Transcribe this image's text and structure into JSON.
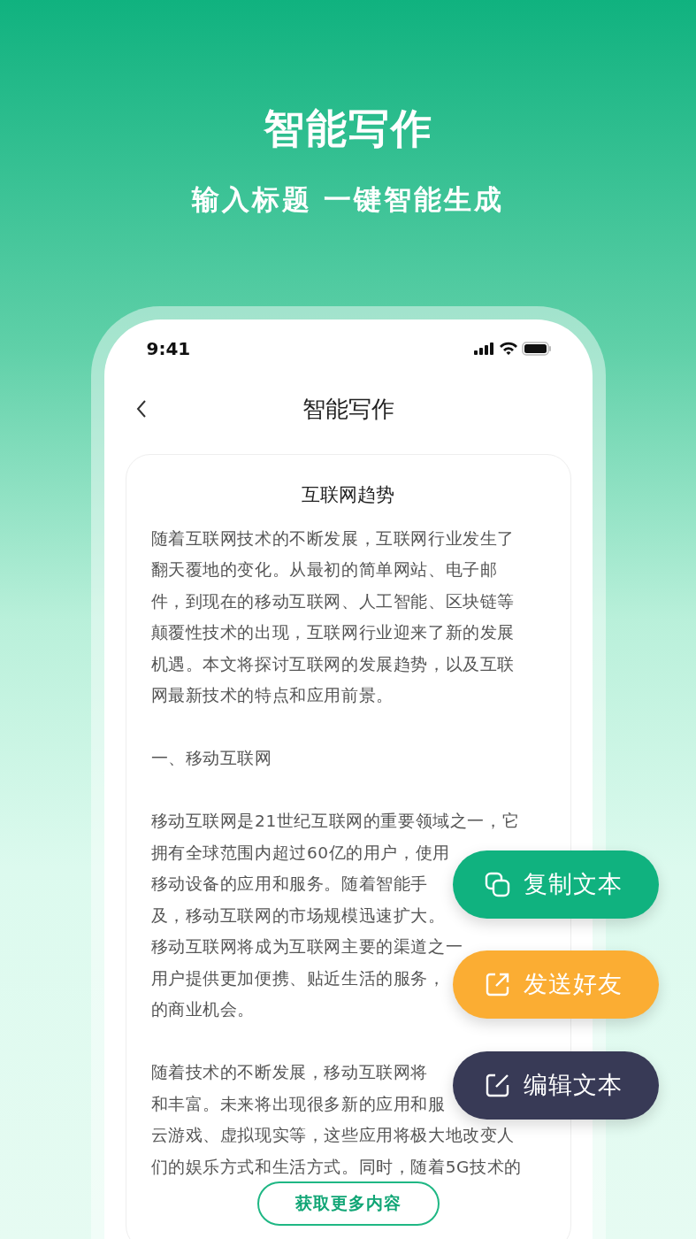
{
  "hero": {
    "title": "智能写作",
    "subtitle": "输入标题 一键智能生成"
  },
  "phone": {
    "status_bar": {
      "time": "9:41"
    },
    "nav_title": "智能写作",
    "article": {
      "title": "互联网趋势",
      "paragraphs": [
        {
          "lines": [
            "随着互联网技术的不断发展，互联网行业发生了",
            "翻天覆地的变化。从最初的简单网站、电子邮",
            "件，到现在的移动互联网、人工智能、区块链等",
            "颠覆性技术的出现，互联网行业迎来了新的发展",
            "机遇。本文将探讨互联网的发展趋势，以及互联",
            "网最新技术的特点和应用前景。"
          ]
        },
        {
          "lines": [
            "一、移动互联网"
          ]
        },
        {
          "lines": [
            "移动互联网是21世纪互联网的重要领域之一，它",
            "拥有全球范围内超过60亿的用户，使用",
            "移动设备的应用和服务。随着智能手",
            "及，移动互联网的市场规模迅速扩大。",
            "移动互联网将成为互联网主要的渠道之一",
            "用户提供更加便携、贴近生活的服务，",
            "的商业机会。"
          ]
        },
        {
          "lines": [
            "随着技术的不断发展，移动互联网将",
            "和丰富。未来将出现很多新的应用和服",
            "云游戏、虚拟现实等，这些应用将极大地改变人",
            "们的娱乐方式和生活方式。同时，随着5G技术的"
          ]
        }
      ],
      "more_button": "获取更多内容"
    }
  },
  "actions": [
    {
      "kind": "copy",
      "label": "复制文本",
      "color": "#10b27f"
    },
    {
      "kind": "share",
      "label": "发送好友",
      "color": "#fbad33"
    },
    {
      "kind": "edit",
      "label": "编辑文本",
      "color": "#383a56"
    }
  ]
}
